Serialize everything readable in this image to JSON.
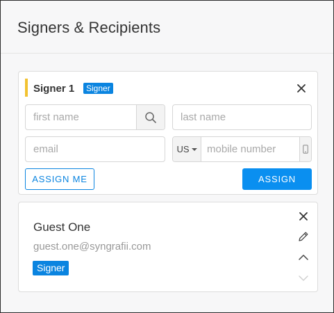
{
  "panel": {
    "title": "Signers & Recipients"
  },
  "signer_form": {
    "title": "Signer 1",
    "badge": "Signer",
    "first_name_placeholder": "first name",
    "last_name_placeholder": "last name",
    "email_placeholder": "email",
    "country_code": "US",
    "mobile_placeholder": "mobile number",
    "assign_me_label": "ASSIGN ME",
    "assign_label": "ASSIGN"
  },
  "recipient": {
    "name": "Guest One",
    "email": "guest.one@syngrafii.com",
    "role": "Signer"
  },
  "colors": {
    "accent": "#0a84e0",
    "signer_marker": "#f2c230"
  },
  "icons": [
    "close-icon",
    "search-icon",
    "caret-down-icon",
    "phone-icon",
    "pencil-icon",
    "chevron-up-icon",
    "chevron-down-icon"
  ]
}
